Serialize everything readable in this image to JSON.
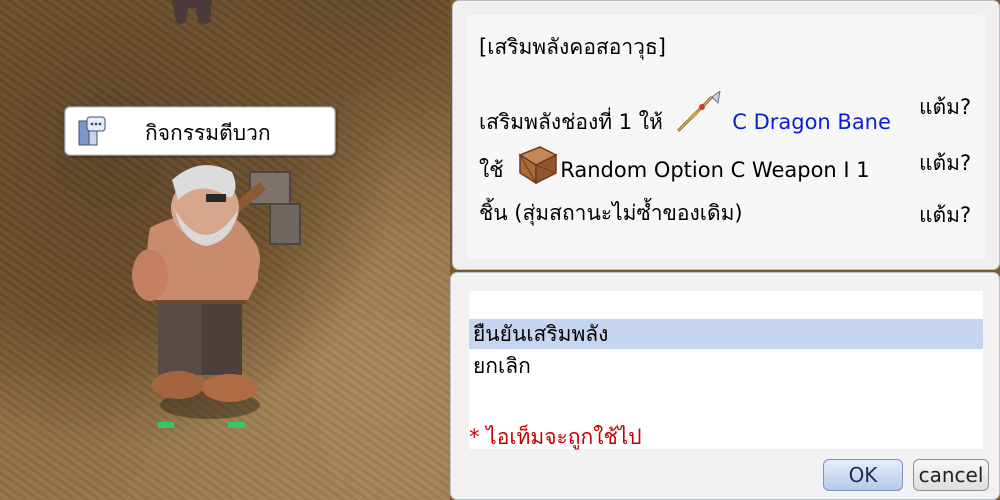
{
  "npc": {
    "name": "กิจกรรมตีบวก",
    "icon": "chat-bubble-icon"
  },
  "dialog": {
    "title": "[เสริมพลังคอสอาวุธ]",
    "line1_prefix": "เสริมพลังช่องที่ 1 ให้",
    "item_icon": "spear-icon",
    "item_name": "C Dragon Bane",
    "line1_suffix": "แต้ม?",
    "line2_prefix": "ใช้",
    "box_icon": "item-box-icon",
    "line2_item": "Random Option C Weapon I 1",
    "line2_suffix": "แต้ม?",
    "line3_text": "ชิ้น (สุ่มสถานะไม่ซ้ำของเดิม)",
    "line3_suffix": "แต้ม?"
  },
  "menu": {
    "options": [
      "ยืนยันเสริมพลัง",
      "ยกเลิก"
    ],
    "selected_index": 0,
    "note": "* ไอเท็มจะถูกใช้ไป",
    "ok_label": "OK",
    "cancel_label": "cancel"
  },
  "colors": {
    "item_link": "#0b1fd0",
    "warning_note": "#c40000",
    "selected_row": "#c6d6f1"
  }
}
